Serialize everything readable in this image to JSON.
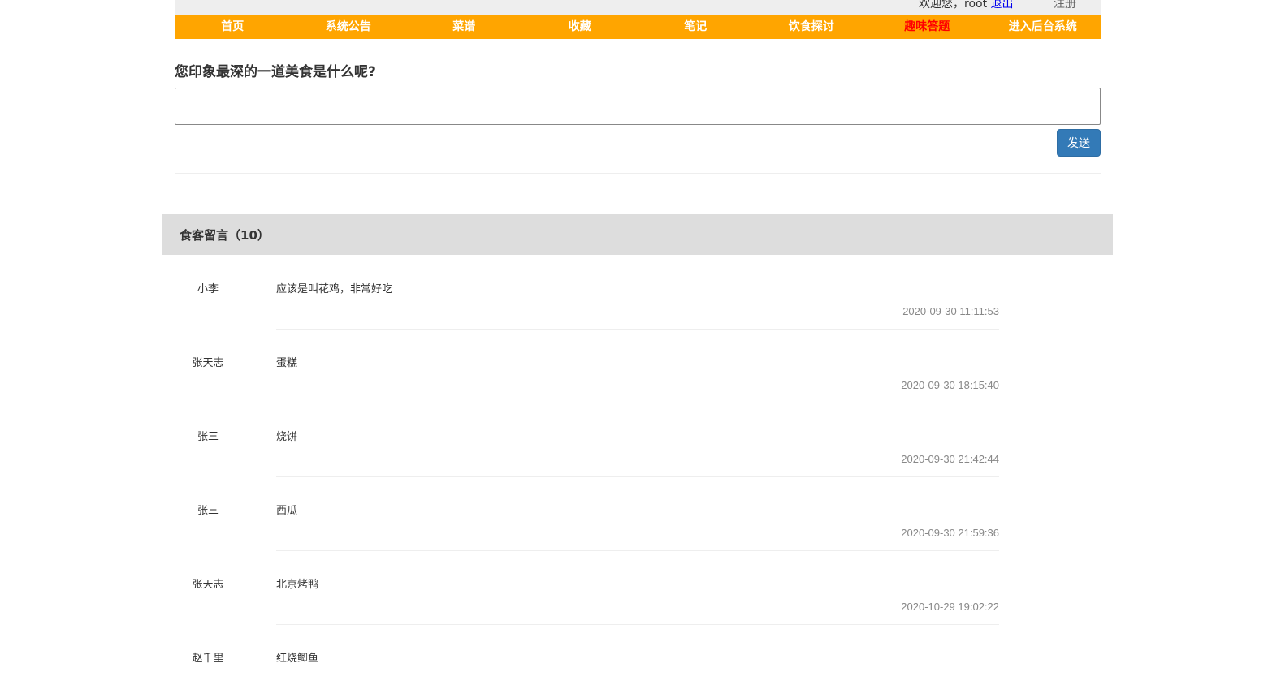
{
  "topbar": {
    "welcome": "欢迎您，root",
    "logout": "退出",
    "register": "注册"
  },
  "nav": {
    "items": [
      {
        "label": "首页"
      },
      {
        "label": "系统公告"
      },
      {
        "label": "菜谱"
      },
      {
        "label": "收藏"
      },
      {
        "label": "笔记"
      },
      {
        "label": "饮食探讨"
      },
      {
        "label": "趣味答题"
      },
      {
        "label": "进入后台系统"
      }
    ],
    "active_color": "#ff0000",
    "bar_color": "#ffa500"
  },
  "quiz": {
    "question": "您印象最深的一道美食是什么呢?",
    "answer_value": "",
    "send_label": "发送"
  },
  "messages": {
    "header": "食客留言（10）",
    "items": [
      {
        "author": "小李",
        "content": "应该是叫花鸡，非常好吃",
        "time": "2020-09-30 11:11:53"
      },
      {
        "author": "张天志",
        "content": "蛋糕",
        "time": "2020-09-30 18:15:40"
      },
      {
        "author": "张三",
        "content": "烧饼",
        "time": "2020-09-30 21:42:44"
      },
      {
        "author": "张三",
        "content": "西瓜",
        "time": "2020-09-30 21:59:36"
      },
      {
        "author": "张天志",
        "content": "北京烤鸭",
        "time": "2020-10-29 19:02:22"
      },
      {
        "author": "赵千里",
        "content": "红烧鲫鱼",
        "time": ""
      }
    ]
  }
}
